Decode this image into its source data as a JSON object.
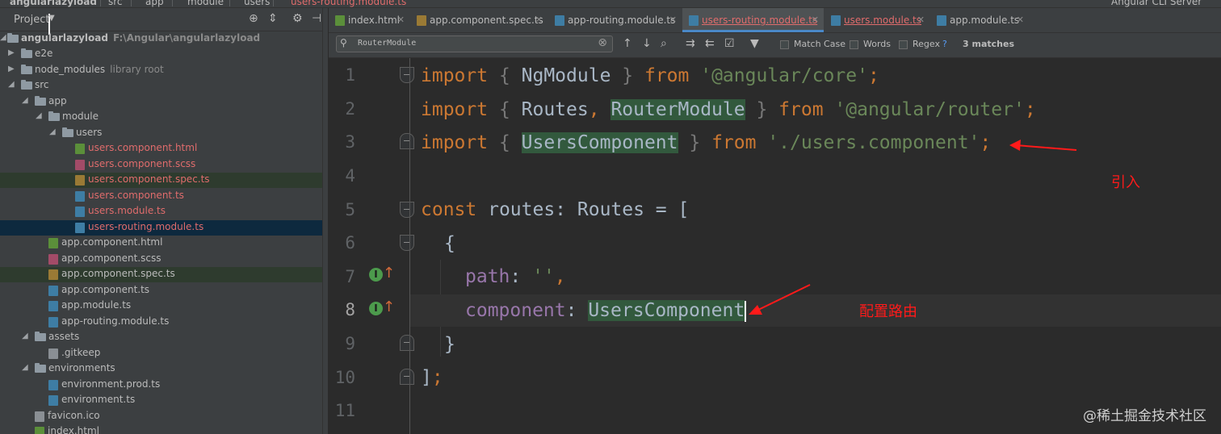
{
  "breadcrumb": {
    "items": [
      "angularlazyload",
      "src",
      "app",
      "module",
      "users",
      "users-routing.module.ts"
    ],
    "run_config": "Angular CLI Server"
  },
  "project_panel": {
    "title": "Project",
    "root_label": "angularlazyload",
    "root_path": "F:\\Angular\\angularlazyload",
    "tree": [
      {
        "label": "e2e",
        "kind": "folder",
        "expanded": false
      },
      {
        "label": "node_modules",
        "kind": "folder",
        "expanded": false,
        "hint": "library root"
      },
      {
        "label": "src",
        "kind": "folder",
        "expanded": true
      },
      {
        "label": "app",
        "kind": "folder",
        "expanded": true
      },
      {
        "label": "module",
        "kind": "folder",
        "expanded": true
      },
      {
        "label": "users",
        "kind": "folder",
        "expanded": true
      },
      {
        "label": "users.component.html",
        "kind": "html"
      },
      {
        "label": "users.component.scss",
        "kind": "scss"
      },
      {
        "label": "users.component.spec.ts",
        "kind": "spec"
      },
      {
        "label": "users.component.ts",
        "kind": "ts"
      },
      {
        "label": "users.module.ts",
        "kind": "ts"
      },
      {
        "label": "users-routing.module.ts",
        "kind": "ts"
      },
      {
        "label": "app.component.html",
        "kind": "html"
      },
      {
        "label": "app.component.scss",
        "kind": "scss"
      },
      {
        "label": "app.component.spec.ts",
        "kind": "spec"
      },
      {
        "label": "app.component.ts",
        "kind": "ts"
      },
      {
        "label": "app.module.ts",
        "kind": "ts"
      },
      {
        "label": "app-routing.module.ts",
        "kind": "ts"
      },
      {
        "label": "assets",
        "kind": "folder",
        "expanded": true
      },
      {
        "label": ".gitkeep",
        "kind": "plain"
      },
      {
        "label": "environments",
        "kind": "folder",
        "expanded": true
      },
      {
        "label": "environment.prod.ts",
        "kind": "ts"
      },
      {
        "label": "environment.ts",
        "kind": "ts"
      },
      {
        "label": "favicon.ico",
        "kind": "plain"
      },
      {
        "label": "index.html",
        "kind": "html"
      }
    ]
  },
  "tabs": [
    {
      "label": "index.html",
      "kind": "html",
      "active": false,
      "modified": false
    },
    {
      "label": "app.component.spec.ts",
      "kind": "spec",
      "active": false,
      "modified": false
    },
    {
      "label": "app-routing.module.ts",
      "kind": "ts",
      "active": false,
      "modified": false
    },
    {
      "label": "users-routing.module.ts",
      "kind": "ts",
      "active": true,
      "modified": true
    },
    {
      "label": "users.module.ts",
      "kind": "ts",
      "active": false,
      "modified": true
    },
    {
      "label": "app.module.ts",
      "kind": "ts",
      "active": false,
      "modified": false
    }
  ],
  "find_bar": {
    "query": "RouterModule",
    "match_case_label": "Match Case",
    "words_label": "Words",
    "regex_label": "Regex",
    "regex_help": "?",
    "matches": "3 matches"
  },
  "code": {
    "line_numbers": [
      "1",
      "2",
      "3",
      "4",
      "5",
      "6",
      "7",
      "8",
      "9",
      "10",
      "11"
    ],
    "lines": {
      "l1": {
        "import": "import",
        "ob": " { ",
        "name": "NgModule",
        "cb": " } ",
        "from": "from",
        "sp": " ",
        "path": "'@angular/core'",
        "semi": ";"
      },
      "l2": {
        "import": "import",
        "ob": " { ",
        "name1": "Routes",
        "comma": ", ",
        "name2": "RouterModule",
        "cb": " } ",
        "from": "from",
        "sp": " ",
        "path": "'@angular/router'",
        "semi": ";"
      },
      "l3": {
        "import": "import",
        "ob": " { ",
        "name": "UsersComponent",
        "cb": " } ",
        "from": "from",
        "sp": " ",
        "path": "'./users.component'",
        "semi": ";"
      },
      "l5": {
        "const": "const",
        "decl": " routes: Routes = ",
        "bracket": "["
      },
      "l6": {
        "text": "{"
      },
      "l7": {
        "key": "path",
        "colon": ": ",
        "value": "''",
        "comma": ","
      },
      "l8": {
        "key": "component",
        "colon": ": ",
        "value": "UsersComponent"
      },
      "l9": {
        "text": "}"
      },
      "l10": {
        "bracket": "]",
        "semi": ";"
      }
    }
  },
  "annotations": {
    "import_note": "引入",
    "config_note": "配置路由"
  },
  "watermark": "@稀土掘金技术社区",
  "colors": {
    "keyword": "#cc7832",
    "string": "#6a8759",
    "property": "#9876aa",
    "match_highlight": "#32593d",
    "annotation": "#ff1a1a"
  }
}
